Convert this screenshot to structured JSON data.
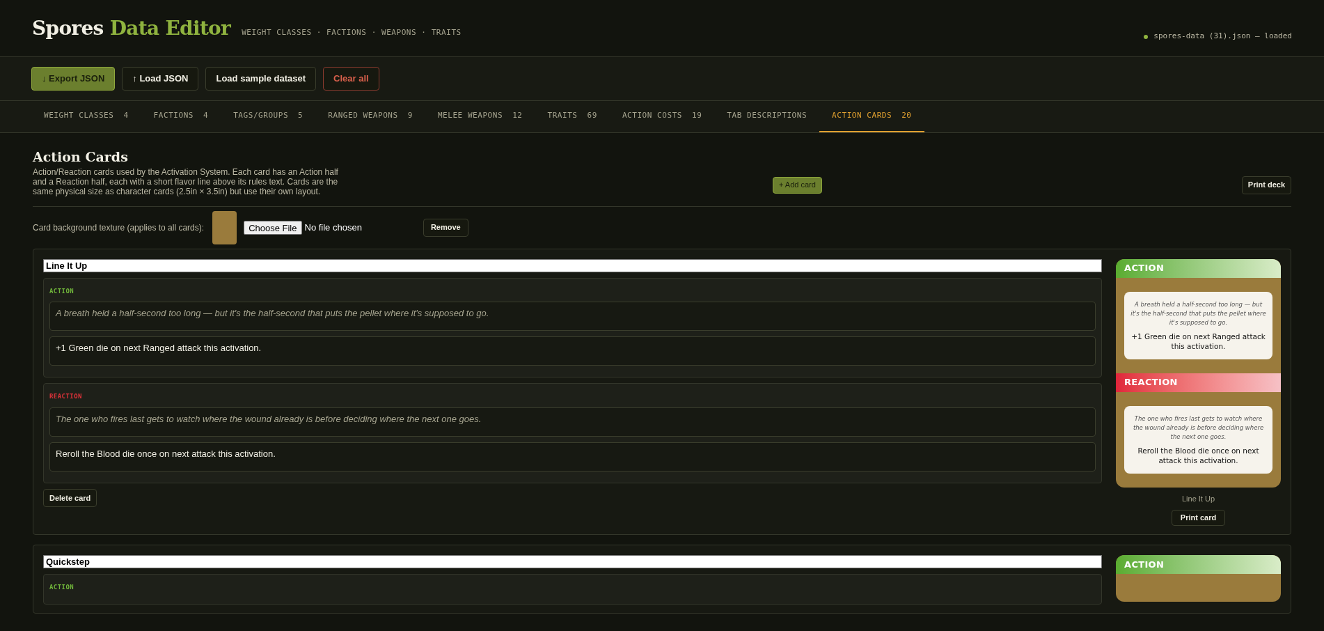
{
  "header": {
    "title_main": "Spores",
    "title_accent": "Data Editor",
    "subtitle": "WEIGHT CLASSES · FACTIONS · WEAPONS · TRAITS",
    "status": "spores-data (31).json — loaded"
  },
  "toolbar": [
    {
      "kind": "primary",
      "label": "↓ Export JSON"
    },
    {
      "kind": "default",
      "label": "↑ Load JSON"
    },
    {
      "kind": "default",
      "label": "Load sample dataset"
    },
    {
      "kind": "danger",
      "label": "Clear all"
    }
  ],
  "tabs": [
    {
      "label": "WEIGHT CLASSES",
      "count": "4",
      "selected": false
    },
    {
      "label": "FACTIONS",
      "count": "4",
      "selected": false
    },
    {
      "label": "TAGS/GROUPS",
      "count": "5",
      "selected": false
    },
    {
      "label": "RANGED WEAPONS",
      "count": "9",
      "selected": false
    },
    {
      "label": "MELEE WEAPONS",
      "count": "12",
      "selected": false
    },
    {
      "label": "TRAITS",
      "count": "69",
      "selected": false
    },
    {
      "label": "ACTION COSTS",
      "count": "19",
      "selected": false
    },
    {
      "label": "TAB DESCRIPTIONS",
      "selected": false
    },
    {
      "label": "ACTION CARDS",
      "count": "20",
      "selected": true
    }
  ],
  "section": {
    "title": "Action Cards",
    "description": "Action/Reaction cards used by the Activation System. Each card has an Action half and a Reaction half, each with a short flavor line above its rules text. Cards are the same physical size as character cards (2.5in × 3.5in) but use their own layout.",
    "add_button": "+ Add card",
    "print_button": "Print deck"
  },
  "texture": {
    "label": "Card background texture (applies to all cards):",
    "choose_button": "Choose File",
    "file_status": "No file chosen",
    "remove_button": "Remove"
  },
  "cards": [
    {
      "title": "Line It Up",
      "halves": [
        {
          "kind": "action",
          "label": "ACTION",
          "flavor": "A breath held a half-second too long — but it's the half-second that puts the pellet where it's supposed to go.",
          "rules": "+1 Green die on next Ranged attack this activation."
        },
        {
          "kind": "reaction",
          "label": "REACTION",
          "flavor": "The one who fires last gets to watch where the wound already is before deciding where the next one goes.",
          "rules": "Reroll the Blood die once on next attack this activation."
        }
      ],
      "delete_button": "Delete card",
      "preview": {
        "halves": [
          {
            "kind": "action",
            "header": "ACTION",
            "flavor": "A breath held a half-second too long — but it's the half-second that puts the pellet where it's supposed to go.",
            "rules": "+1 Green die on next Ranged attack this activation."
          },
          {
            "kind": "reaction",
            "header": "REACTION",
            "flavor": "The one who fires last gets to watch where the wound already is before deciding where the next one goes.",
            "rules": "Reroll the Blood die once on next attack this activation."
          }
        ],
        "caption": "Line It Up",
        "print_button": "Print card"
      }
    },
    {
      "title": "Quickstep",
      "halves": [
        {
          "kind": "action",
          "label": "ACTION"
        }
      ],
      "preview": {
        "halves": [
          {
            "kind": "action",
            "header": "ACTION"
          }
        ]
      }
    }
  ]
}
